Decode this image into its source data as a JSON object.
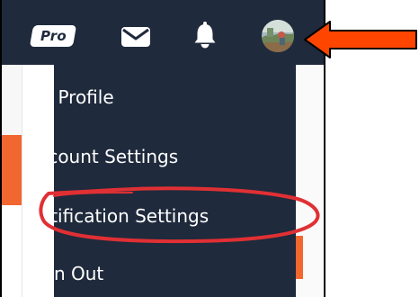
{
  "navbar": {
    "pro_badge": "Pro",
    "icons": [
      "mail-icon",
      "bell-icon",
      "avatar"
    ]
  },
  "dropdown": {
    "items": [
      {
        "label": "My Profile"
      },
      {
        "label": "Account Settings"
      },
      {
        "label": "Notification Settings"
      },
      {
        "label": "Sign Out"
      }
    ]
  },
  "annotations": {
    "arrow_color": "#ff4500",
    "highlight_color": "#e03034"
  },
  "colors": {
    "navbar": "#1f2a3c",
    "accent": "#f2672f",
    "menu_text": "#ffffff"
  }
}
